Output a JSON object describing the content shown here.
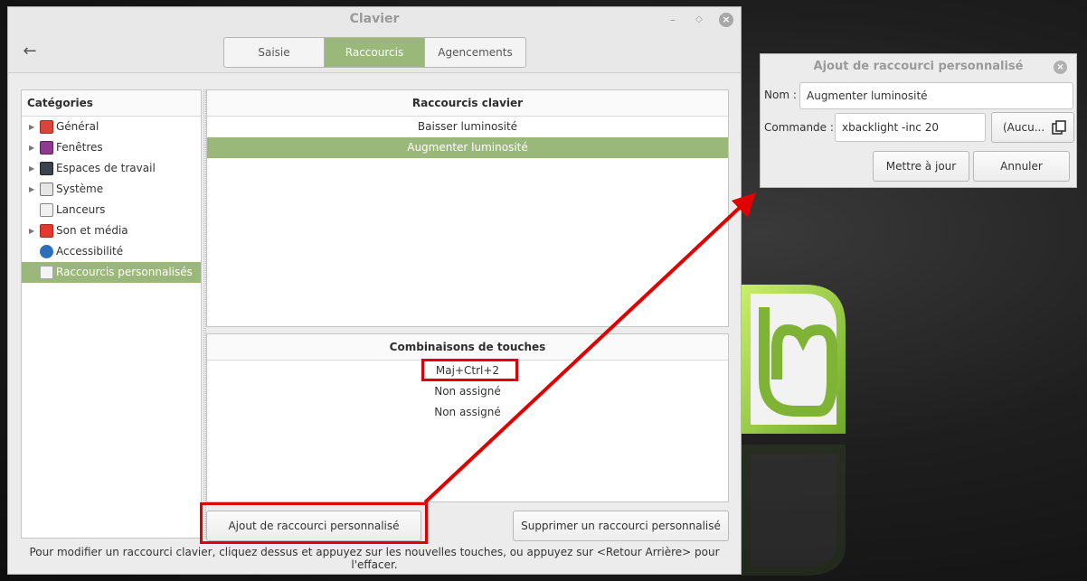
{
  "main_window": {
    "title": "Clavier",
    "tabs": [
      {
        "label": "Saisie",
        "active": false
      },
      {
        "label": "Raccourcis",
        "active": true
      },
      {
        "label": "Agencements",
        "active": false
      }
    ],
    "categories": {
      "header": "Catégories",
      "items": [
        {
          "label": "Général",
          "icon": "general-icon",
          "expandable": true,
          "selected": false
        },
        {
          "label": "Fenêtres",
          "icon": "windows-icon",
          "expandable": true,
          "selected": false
        },
        {
          "label": "Espaces de travail",
          "icon": "workspaces-icon",
          "expandable": true,
          "selected": false
        },
        {
          "label": "Système",
          "icon": "system-icon",
          "expandable": true,
          "selected": false
        },
        {
          "label": "Lanceurs",
          "icon": "launchers-icon",
          "expandable": false,
          "selected": false
        },
        {
          "label": "Son et média",
          "icon": "sound-media-icon",
          "expandable": true,
          "selected": false
        },
        {
          "label": "Accessibilité",
          "icon": "accessibility-icon",
          "expandable": false,
          "selected": false
        },
        {
          "label": "Raccourcis personnalisés",
          "icon": "custom-shortcuts-icon",
          "expandable": false,
          "selected": true
        }
      ]
    },
    "shortcuts": {
      "header": "Raccourcis clavier",
      "items": [
        {
          "label": "Baisser luminosité",
          "selected": false
        },
        {
          "label": "Augmenter luminosité",
          "selected": true
        }
      ]
    },
    "keybindings": {
      "header": "Combinaisons de touches",
      "items": [
        "Maj+Ctrl+2",
        "Non assigné",
        "Non assigné"
      ]
    },
    "buttons": {
      "add": "Ajout de raccourci personnalisé",
      "remove": "Supprimer un raccourci personnalisé"
    },
    "hint": "Pour modifier un raccourci clavier, cliquez dessus et appuyez sur les nouvelles touches, ou appuyez sur <Retour Arrière> pour l'effacer."
  },
  "dialog": {
    "title": "Ajout de raccourci personnalisé",
    "name_label": "Nom :",
    "name_value": "Augmenter luminosité",
    "command_label": "Commande :",
    "command_value": "xbacklight -inc 20",
    "picker_label": "(Aucu...",
    "update_button": "Mettre à jour",
    "cancel_button": "Annuler"
  },
  "colors": {
    "accent": "#9ab87a",
    "annotation": "#e00000"
  }
}
